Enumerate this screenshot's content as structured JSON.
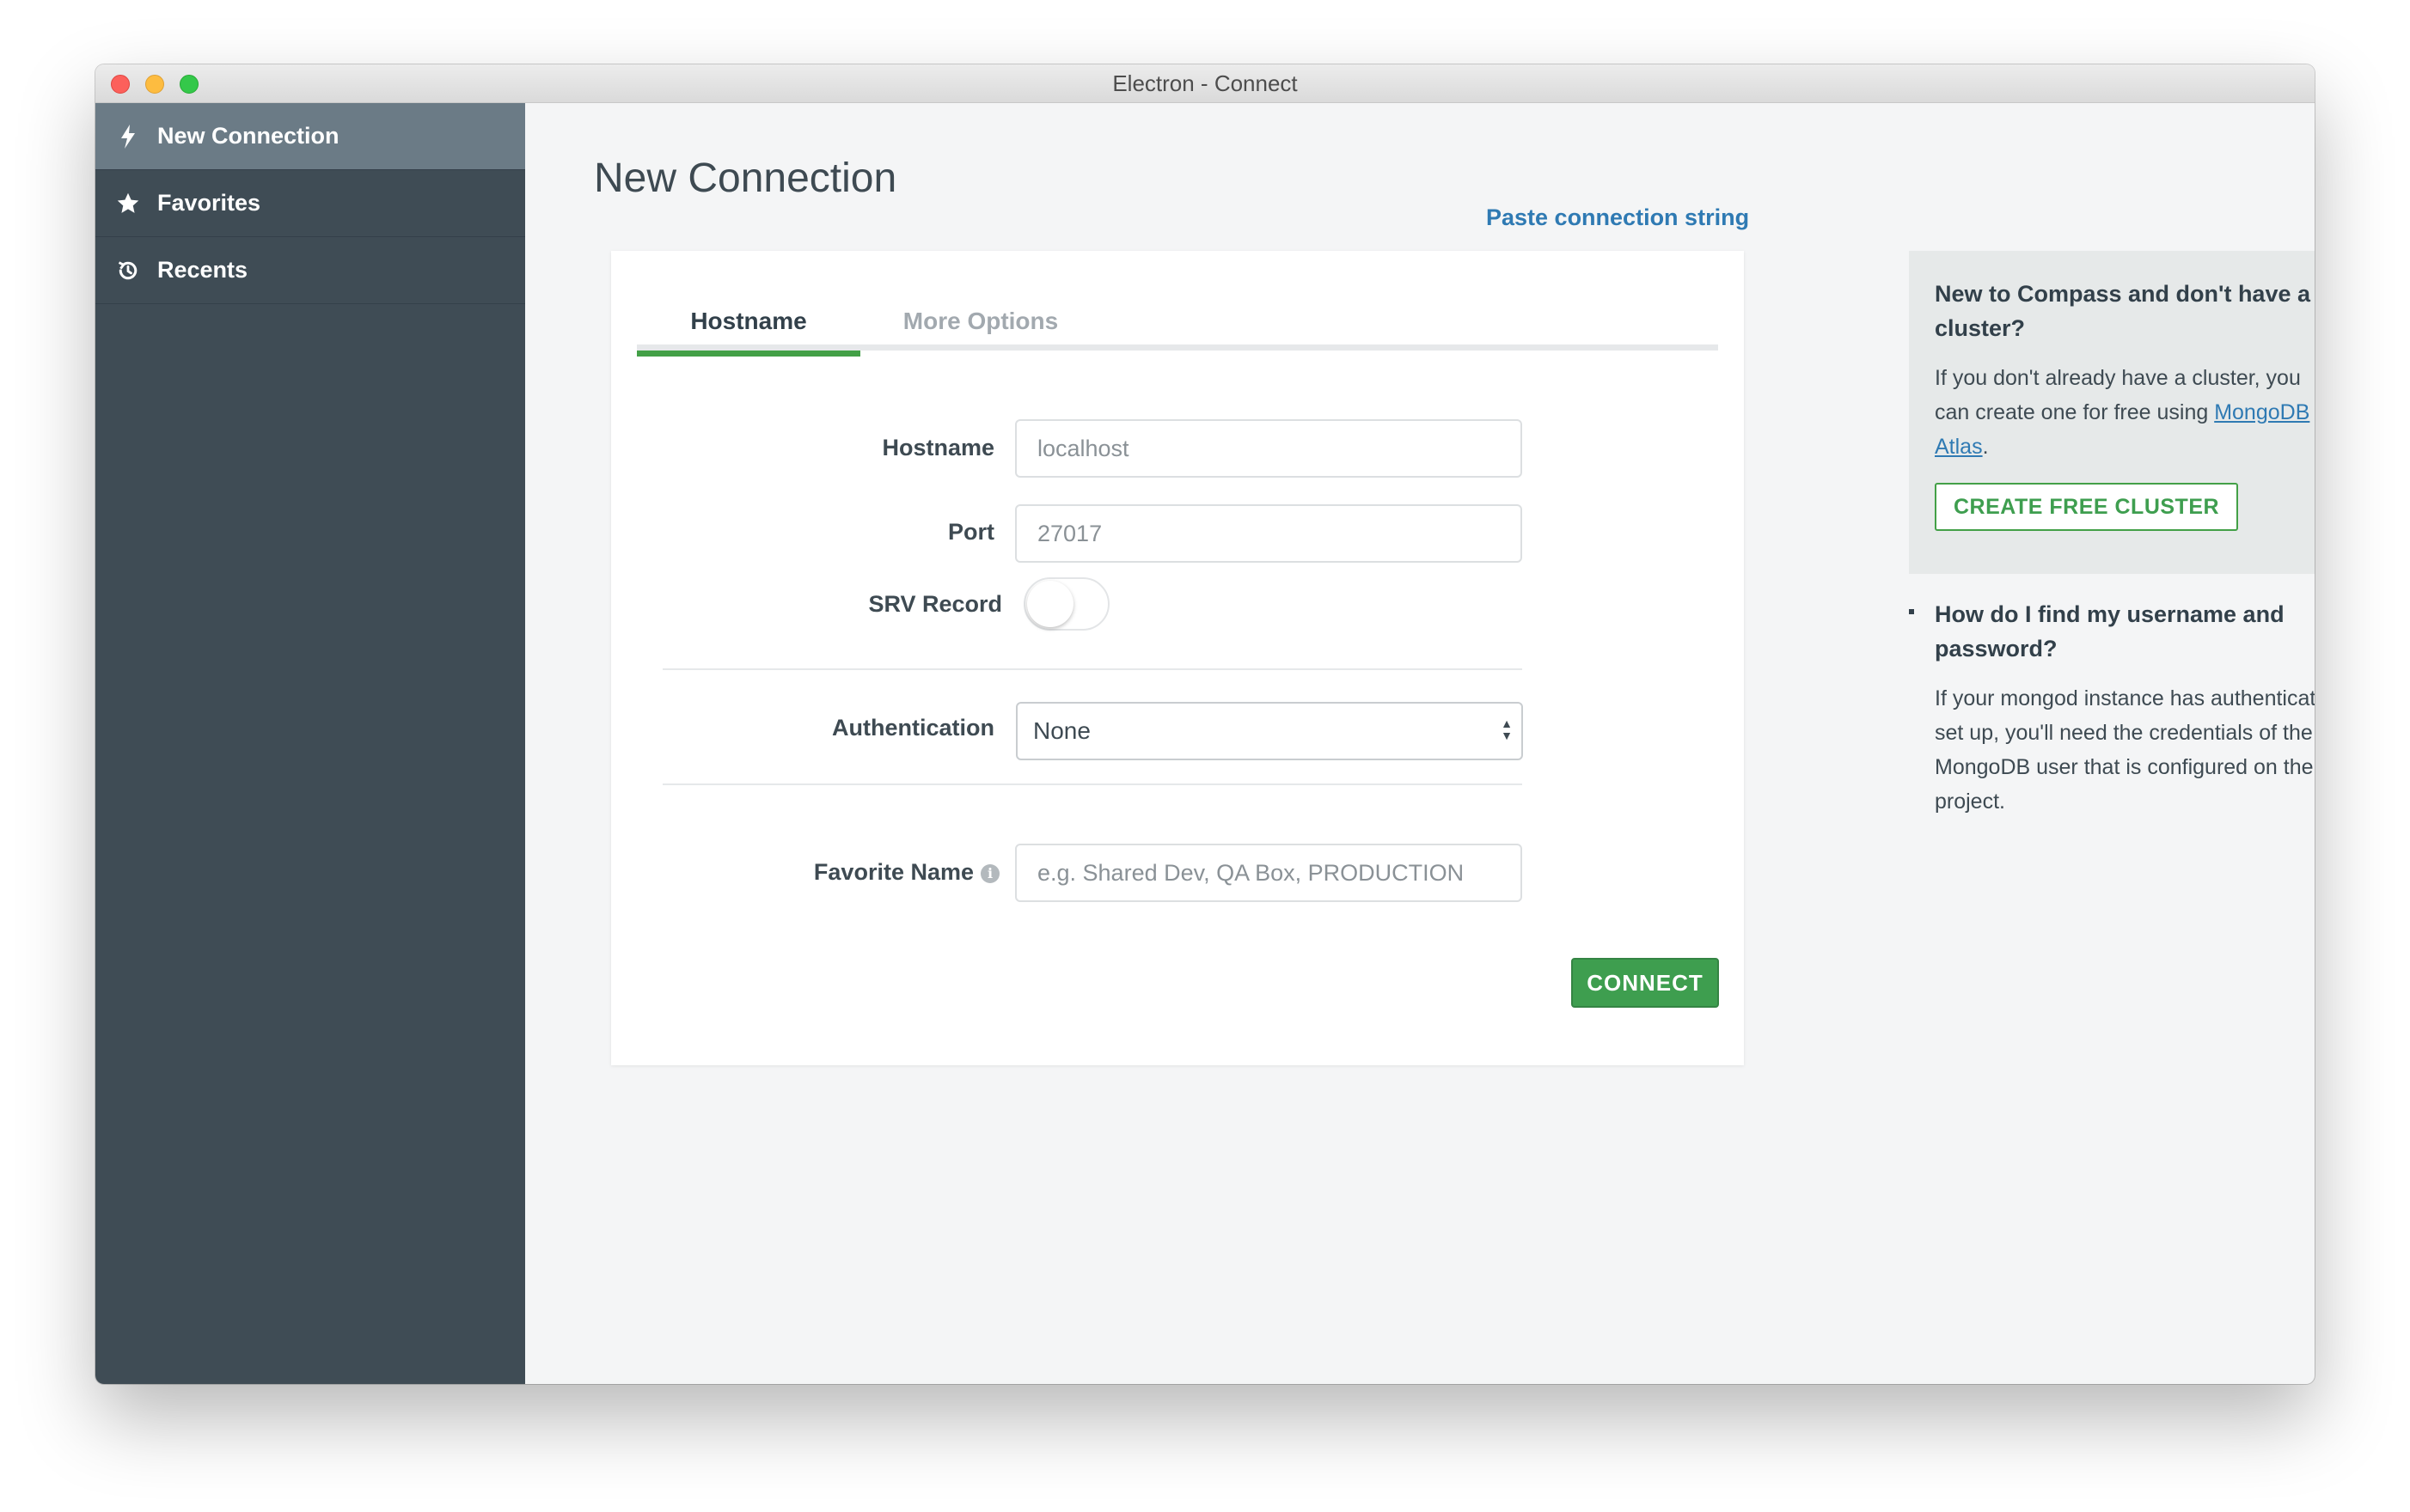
{
  "window": {
    "title": "Electron - Connect"
  },
  "sidebar": {
    "items": [
      {
        "label": "New Connection",
        "icon": "lightning-bolt-icon",
        "active": true
      },
      {
        "label": "Favorites",
        "icon": "star-icon",
        "active": false
      },
      {
        "label": "Recents",
        "icon": "history-icon",
        "active": false
      }
    ]
  },
  "main": {
    "title": "New Connection",
    "paste_link": "Paste connection string",
    "tabs": [
      {
        "label": "Hostname",
        "active": true
      },
      {
        "label": "More Options",
        "active": false
      }
    ],
    "form": {
      "hostname_label": "Hostname",
      "hostname_placeholder": "localhost",
      "port_label": "Port",
      "port_placeholder": "27017",
      "srv_label": "SRV Record",
      "srv_enabled": false,
      "auth_label": "Authentication",
      "auth_value": "None",
      "favorite_label": "Favorite Name",
      "favorite_placeholder": "e.g. Shared Dev, QA Box, PRODUCTION",
      "connect_label": "CONNECT"
    }
  },
  "help": {
    "cluster_heading": "New to Compass and don't have a cluster?",
    "cluster_body_prefix": "If you don't already have a cluster, you can create one for free using ",
    "cluster_link": "MongoDB Atlas",
    "cluster_body_suffix": ".",
    "cluster_button": "CREATE FREE CLUSTER",
    "faq_heading": "How do I find my username and password?",
    "faq_body": "If your mongod instance has authentication set up, you'll need the credentials of the MongoDB user that is configured on the project."
  },
  "colors": {
    "sidebar_bg": "#3f4c55",
    "sidebar_active": "#6b7b86",
    "accent_green": "#43a047",
    "link_blue": "#2f7ab3"
  }
}
